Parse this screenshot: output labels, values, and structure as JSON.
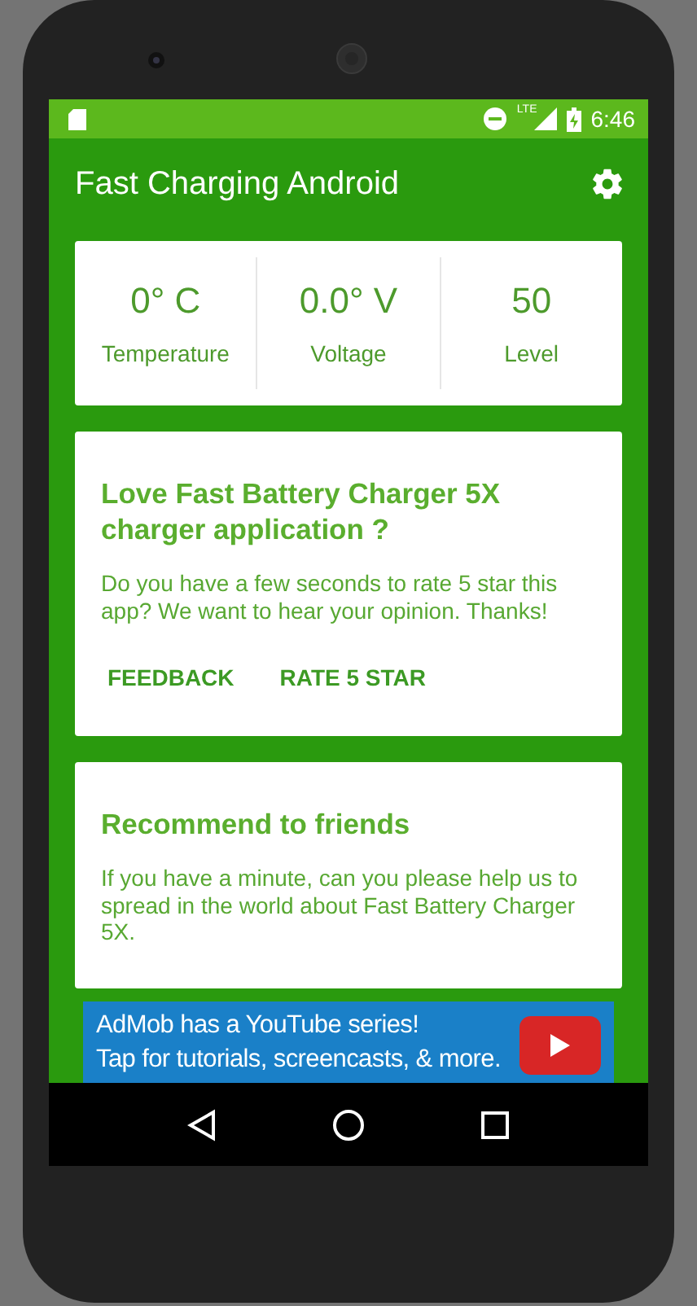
{
  "status_bar": {
    "network": "LTE",
    "time": "6:46"
  },
  "app_bar": {
    "title": "Fast Charging Android"
  },
  "stats": [
    {
      "value": "0° C",
      "label": "Temperature"
    },
    {
      "value": "0.0° V",
      "label": "Voltage"
    },
    {
      "value": "50",
      "label": "Level"
    }
  ],
  "rate_card": {
    "title": "Love Fast Battery Charger 5X charger application ?",
    "body": "Do you have a few seconds to rate 5 star this app? We want to hear your opinion. Thanks!",
    "actions": [
      "FEEDBACK",
      "RATE 5 STAR"
    ]
  },
  "recommend_card": {
    "title": "Recommend to friends",
    "body": "If you have a minute, can you please help us to spread in the world about Fast Battery Charger 5X."
  },
  "ad_banner": {
    "lines": [
      "AdMob has a YouTube series!",
      "Tap for tutorials, screencasts, & more."
    ]
  }
}
